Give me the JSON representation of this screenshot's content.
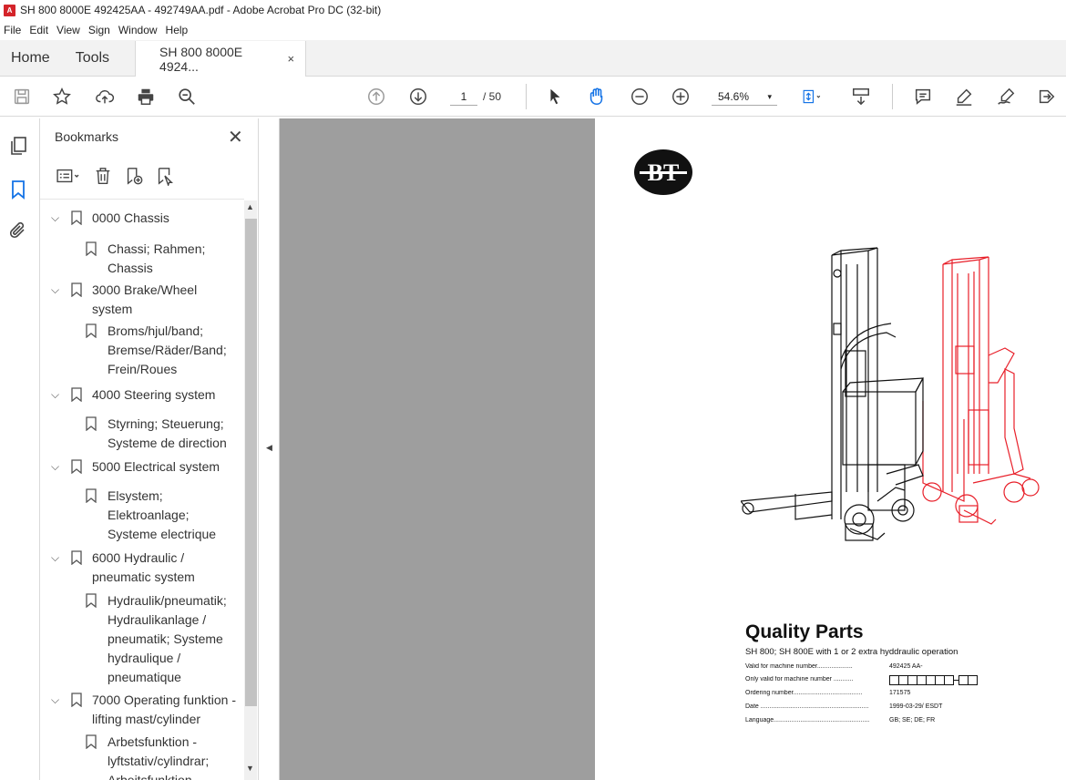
{
  "window": {
    "title": "SH 800 8000E 492425AA - 492749AA.pdf - Adobe Acrobat Pro DC (32-bit)",
    "icon": "pdf-icon"
  },
  "menu": [
    "File",
    "Edit",
    "View",
    "Sign",
    "Window",
    "Help"
  ],
  "tabs": {
    "home": "Home",
    "tools": "Tools",
    "doc": "SH 800 8000E 4924...",
    "close": "×"
  },
  "toolbar": {
    "page_current": "1",
    "page_total": "/ 50",
    "zoom": "54.6%",
    "zoom_dropdown": "▾"
  },
  "bookmarks": {
    "title": "Bookmarks",
    "close": "✕",
    "items": [
      {
        "label": "0000 Chassis",
        "level": 0
      },
      {
        "label": "Chassi; Rahmen; Chassis",
        "level": 1
      },
      {
        "label": "3000 Brake/Wheel system",
        "level": 0
      },
      {
        "label": "Broms/hjul/band; Bremse/Räder/Band; Frein/Roues",
        "level": 1
      },
      {
        "label": "4000 Steering system",
        "level": 0
      },
      {
        "label": "Styrning; Steuerung; Systeme de direction",
        "level": 1
      },
      {
        "label": "5000 Electrical system",
        "level": 0
      },
      {
        "label": "Elsystem; Elektroanlage; Systeme electrique",
        "level": 1
      },
      {
        "label": "6000 Hydraulic / pneumatic system",
        "level": 0
      },
      {
        "label": "Hydraulik/pneumatik; Hydraulikanlage / pneumatik; Systeme hydraulique / pneumatique",
        "level": 1
      },
      {
        "label": "7000 Operating funktion - lifting mast/cylinder",
        "level": 0
      },
      {
        "label": "Arbetsfunktion - lyftstativ/cylindrar; Arbeitsfunktion",
        "level": 1
      }
    ]
  },
  "document": {
    "logo": "BT",
    "title": "Quality Parts",
    "subtitle": "SH 800; SH 800E with 1 or 2 extra hyddraulic operation",
    "fields": [
      {
        "label": "Valid for machine number....................",
        "value": "492425 AA-"
      },
      {
        "label": "Only valid for machine number ...........",
        "value": ""
      },
      {
        "label": "Ordering number.......................................",
        "value": "171575"
      },
      {
        "label": "Date .............................................................",
        "value": "1999-03-29/ ESDT"
      },
      {
        "label": "Language......................................................",
        "value": "GB; SE; DE; FR"
      }
    ]
  },
  "colors": {
    "accent_red": "#d4242a",
    "viewer_grey": "#9e9e9e",
    "forklift_red": "#e8202a"
  }
}
